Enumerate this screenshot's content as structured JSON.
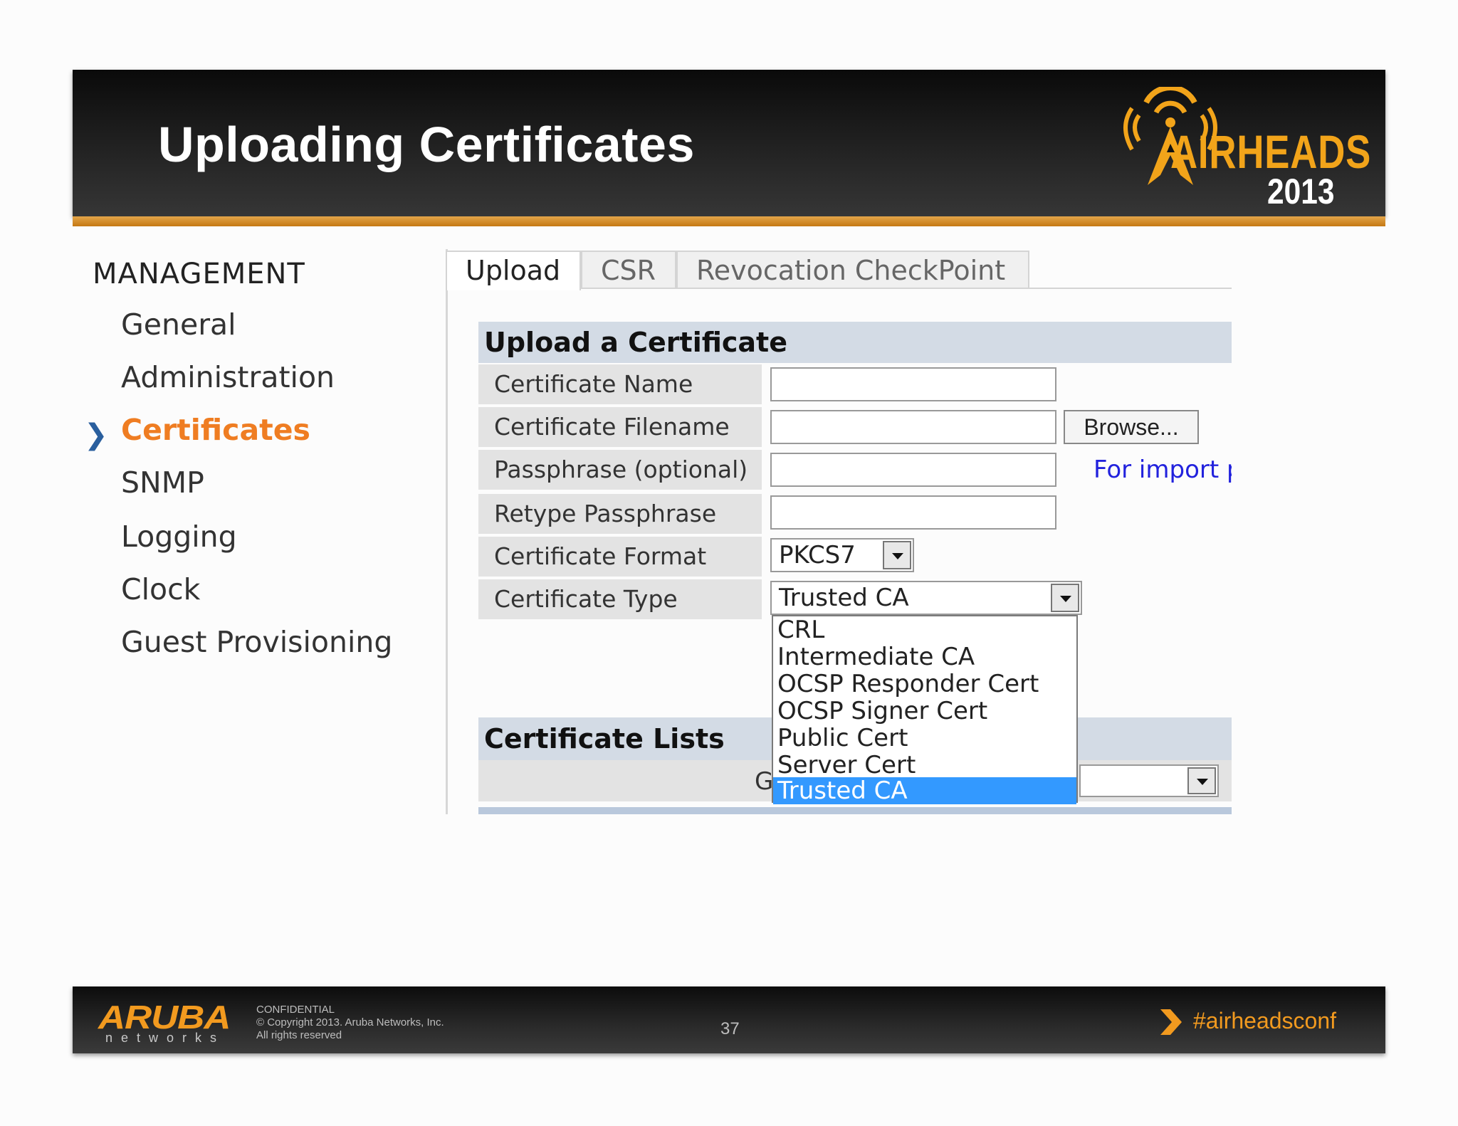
{
  "slide": {
    "title": "Uploading Certificates",
    "logo_text": "AIRHEADS",
    "logo_year": "2013"
  },
  "menu": {
    "heading": "MANAGEMENT",
    "items": [
      {
        "label": "General",
        "active": false
      },
      {
        "label": "Administration",
        "active": false
      },
      {
        "label": "Certificates",
        "active": true
      },
      {
        "label": "SNMP",
        "active": false
      },
      {
        "label": "Logging",
        "active": false
      },
      {
        "label": "Clock",
        "active": false
      },
      {
        "label": "Guest Provisioning",
        "active": false
      }
    ]
  },
  "tabs": [
    {
      "label": "Upload",
      "active": true
    },
    {
      "label": "CSR",
      "active": false
    },
    {
      "label": "Revocation CheckPoint",
      "active": false
    }
  ],
  "upload_form": {
    "section_title": "Upload a Certificate",
    "rows": [
      {
        "label": "Certificate Name",
        "value": ""
      },
      {
        "label": "Certificate Filename",
        "value": ""
      },
      {
        "label": "Passphrase (optional)",
        "value": ""
      },
      {
        "label": "Retype Passphrase",
        "value": ""
      },
      {
        "label": "Certificate Format",
        "value": "PKCS7"
      },
      {
        "label": "Certificate Type",
        "value": "Trusted CA"
      }
    ],
    "browse_label": "Browse...",
    "import_link": "For import p"
  },
  "certificate_type_dropdown": {
    "options": [
      "CRL",
      "Intermediate CA",
      "OCSP Responder Cert",
      "OCSP Signer Cert",
      "Public Cert",
      "Server Cert",
      "Trusted CA"
    ],
    "selected": "Trusted CA"
  },
  "certificate_lists": {
    "section_title": "Certificate Lists",
    "group_label_visible": "G"
  },
  "footer": {
    "brand": "ARUBA",
    "brand_sub": "networks",
    "confidential_lines": [
      "CONFIDENTIAL",
      "© Copyright 2013. Aruba Networks, Inc.",
      "All rights reserved"
    ],
    "page_number": "37",
    "hashtag": "#airheadsconf"
  },
  "colors": {
    "accent_orange": "#ef7d22",
    "selected_blue": "#3399ff",
    "section_header": "#d3dbe5",
    "link_blue": "#2222dd"
  }
}
